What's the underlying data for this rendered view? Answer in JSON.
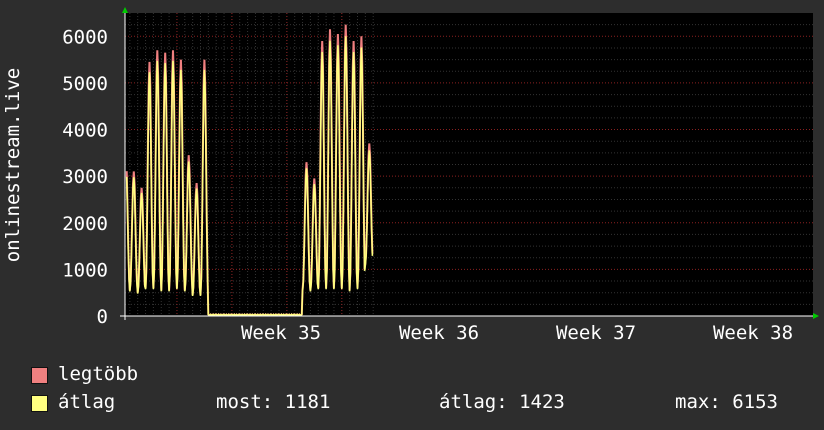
{
  "chart_data": {
    "type": "line",
    "ylabel": "onlinestream.live",
    "yticks": [
      0,
      1000,
      2000,
      3000,
      4000,
      5000,
      6000
    ],
    "ylim": [
      0,
      6500
    ],
    "xticks": [
      "Week 35",
      "Week 36",
      "Week 37",
      "Week 38"
    ],
    "grid": true,
    "series": [
      {
        "name": "legtöbb",
        "color": "#f08080"
      },
      {
        "name": "átlag",
        "color": "#ffff80"
      }
    ],
    "daily_peaks": [
      3400,
      3100,
      2750,
      5450,
      5700,
      5650,
      5700,
      5500,
      3450,
      2850,
      5500,
      null,
      null,
      null,
      null,
      null,
      null,
      null,
      null,
      null,
      null,
      null,
      null,
      3300,
      2950,
      5900,
      6150,
      6050,
      6250,
      5900,
      6000,
      3700
    ],
    "daily_troughs": [
      600,
      550,
      500,
      600,
      600,
      550,
      550,
      600,
      550,
      450,
      450,
      null,
      null,
      null,
      null,
      null,
      null,
      null,
      null,
      null,
      null,
      null,
      null,
      550,
      550,
      600,
      600,
      600,
      600,
      550,
      600,
      1150
    ],
    "outage_level": 20
  },
  "legend": {
    "max_label": "legtöbb",
    "avg_label": "átlag",
    "now_text": "most: 1181",
    "avg_text": "átlag: 1423",
    "max_text": "max: 6153"
  }
}
